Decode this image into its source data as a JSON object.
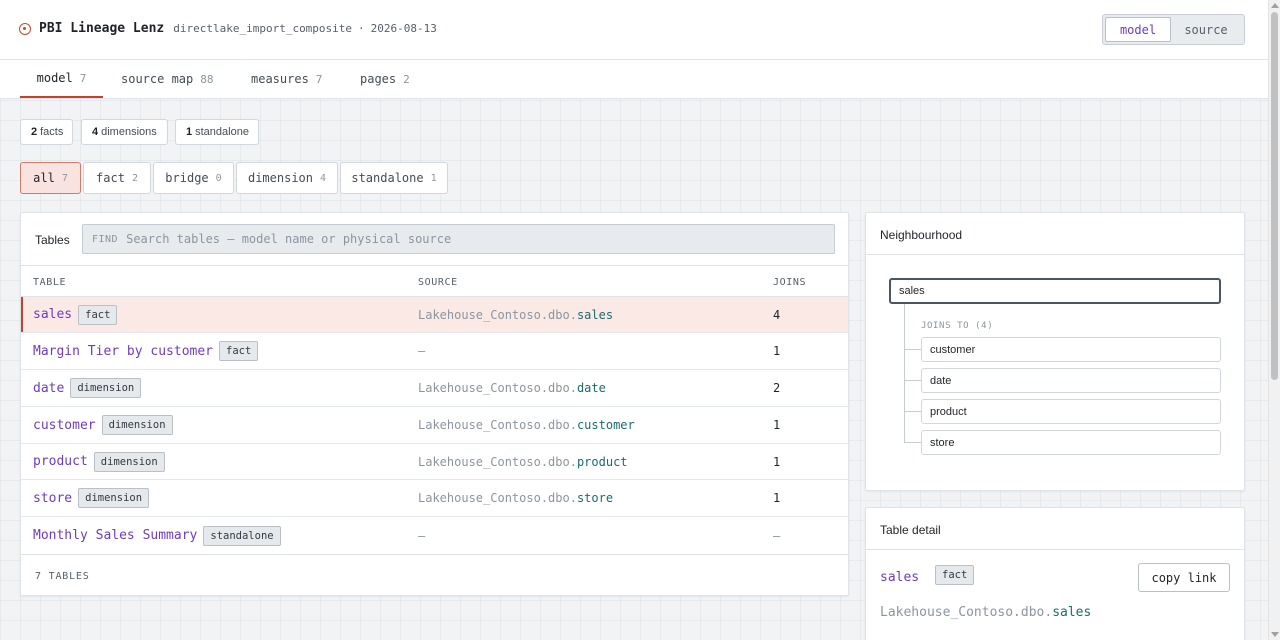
{
  "header": {
    "app_name": "PBI Lineage Lenz",
    "dataset": "directlake_import_composite",
    "separator": "·",
    "date": "2026-08-13",
    "view_toggle": {
      "active": "model",
      "other": "source"
    }
  },
  "tabs": [
    {
      "label": "model",
      "count": "7"
    },
    {
      "label": "source map",
      "count": "88"
    },
    {
      "label": "measures",
      "count": "7"
    },
    {
      "label": "pages",
      "count": "2"
    }
  ],
  "stats": [
    {
      "value": "2",
      "label": "facts"
    },
    {
      "value": "4",
      "label": "dimensions"
    },
    {
      "value": "1",
      "label": "standalone"
    }
  ],
  "filters": [
    {
      "label": "all",
      "count": "7"
    },
    {
      "label": "fact",
      "count": "2"
    },
    {
      "label": "bridge",
      "count": "0"
    },
    {
      "label": "dimension",
      "count": "4"
    },
    {
      "label": "standalone",
      "count": "1"
    }
  ],
  "tables_panel": {
    "title": "Tables",
    "find_label": "FIND",
    "search_placeholder": "Search tables — model name or physical source",
    "columns": {
      "table": "TABLE",
      "source": "SOURCE",
      "joins": "JOINS"
    },
    "rows": [
      {
        "name": "sales",
        "kind": "fact",
        "source_prefix": "Lakehouse_Contoso.dbo.",
        "source_object": "sales",
        "joins": "4"
      },
      {
        "name": "Margin Tier by customer",
        "kind": "fact",
        "source_none": "—",
        "joins": "1"
      },
      {
        "name": "date",
        "kind": "dimension",
        "source_prefix": "Lakehouse_Contoso.dbo.",
        "source_object": "date",
        "joins": "2"
      },
      {
        "name": "customer",
        "kind": "dimension",
        "source_prefix": "Lakehouse_Contoso.dbo.",
        "source_object": "customer",
        "joins": "1"
      },
      {
        "name": "product",
        "kind": "dimension",
        "source_prefix": "Lakehouse_Contoso.dbo.",
        "source_object": "product",
        "joins": "1"
      },
      {
        "name": "store",
        "kind": "dimension",
        "source_prefix": "Lakehouse_Contoso.dbo.",
        "source_object": "store",
        "joins": "1"
      },
      {
        "name": "Monthly Sales Summary",
        "kind": "standalone",
        "source_none": "—",
        "joins": "—"
      }
    ],
    "footer": "7 TABLES"
  },
  "neighbourhood": {
    "title": "Neighbourhood",
    "root": "sales",
    "joins_label": "JOINS TO (4)",
    "children": [
      "customer",
      "date",
      "product",
      "store"
    ]
  },
  "detail": {
    "title": "Table detail",
    "name": "sales",
    "kind": "fact",
    "copy_label": "copy link",
    "source_prefix": "Lakehouse_Contoso.dbo.",
    "source_object": "sales"
  },
  "colors": {
    "accent_red": "#c6402b",
    "name_purple": "#6f3bbf",
    "source_teal": "#1a6c6f"
  }
}
